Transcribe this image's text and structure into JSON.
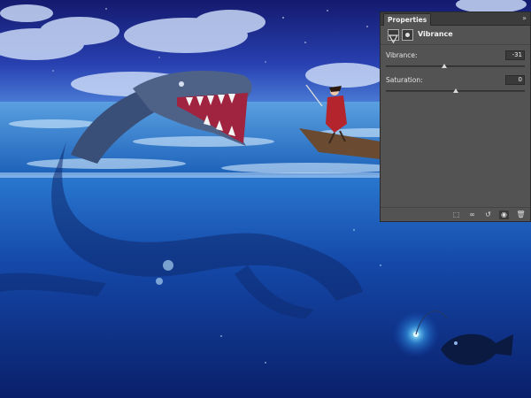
{
  "panel": {
    "tab_label": "Properties",
    "menu_glyph": "»",
    "adjustment": {
      "name": "Vibrance",
      "icon": "vibrance-adjustment-icon",
      "mask_icon": "layer-mask-icon"
    },
    "fields": [
      {
        "label": "Vibrance:",
        "value": "-31",
        "slider_fraction": 0.42
      },
      {
        "label": "Saturation:",
        "value": "0",
        "slider_fraction": 0.5
      }
    ],
    "footer_buttons": [
      {
        "icon": "clip-to-layer-icon",
        "glyph": "⬚"
      },
      {
        "icon": "view-previous-state-icon",
        "glyph": "∞"
      },
      {
        "icon": "reset-icon",
        "glyph": "↺"
      },
      {
        "icon": "visibility-eye-icon",
        "glyph": "◉"
      },
      {
        "icon": "trash-icon",
        "glyph": "🗑"
      }
    ]
  },
  "colors": {
    "sky_top": "#1a1f7a",
    "sea_surface": "#2f7fc4",
    "deep_water": "#0d2c8a",
    "panel_bg": "#535353"
  }
}
